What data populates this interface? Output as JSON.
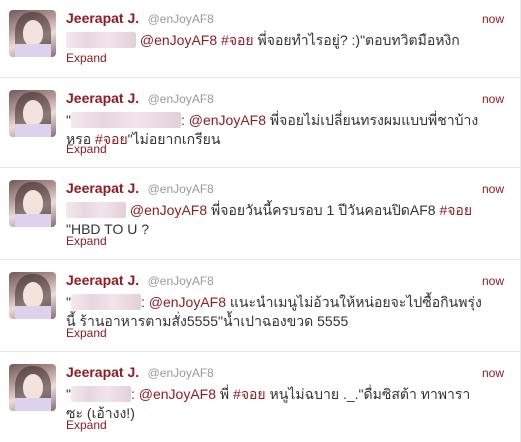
{
  "tweets": [
    {
      "name": "Jeerapat J.",
      "handle": "@enJoyAF8",
      "time": "now",
      "pre": "",
      "mention": "@enJoyAF8",
      "mid": " ",
      "hashtag": "#จอย",
      "post": " พี่จอยทำไรอยู่? :)\"ตอบทวิตมือหงิก",
      "expand": "Expand"
    },
    {
      "name": "Jeerapat J.",
      "handle": "@enJoyAF8",
      "time": "now",
      "pre": "\"",
      "mention": "@enJoyAF8",
      "mid": " พี่จอยไม่เปลี่ยนทรงผมแบบพี่ชาบ้าง หรอ ",
      "hashtag": "#จอย",
      "post": "\"ไม่อยากเกรียน",
      "expand": "Expand"
    },
    {
      "name": "Jeerapat J.",
      "handle": "@enJoyAF8",
      "time": "now",
      "pre": "",
      "mention": "@enJoyAF8",
      "mid": " พี่จอยวันนี้ครบรอบ 1 ปีวันคอนปิดAF8 ",
      "hashtag": "#จอย",
      "post": " \"HBD TO U ?",
      "expand": "Expand"
    },
    {
      "name": "Jeerapat J.",
      "handle": "@enJoyAF8",
      "time": "now",
      "pre": "\"",
      "mention": "@enJoyAF8",
      "mid": " แนะนำเมนูไม่อ้วนให้หน่อยจะไปซื้อกินพรุ่งนี้ ร้านอาหารตามสั่ง5555\"น้ำเปาฉองขวด 5555",
      "hashtag": "",
      "post": "",
      "expand": "Expand"
    },
    {
      "name": "Jeerapat J.",
      "handle": "@enJoyAF8",
      "time": "now",
      "pre": "\"",
      "mention": "@enJoyAF8",
      "mid": " พี่ ",
      "hashtag": "#จอย",
      "post": " หนูไม่ฉบาย ._.\"ดื่มซิสต้า ทาพารา ซะ (เอ้างง!)",
      "expand": "Expand"
    }
  ],
  "colors": {
    "link": "#8e1d22",
    "text": "#333333",
    "muted": "#999999"
  },
  "icons": [
    "avatar-photo"
  ]
}
